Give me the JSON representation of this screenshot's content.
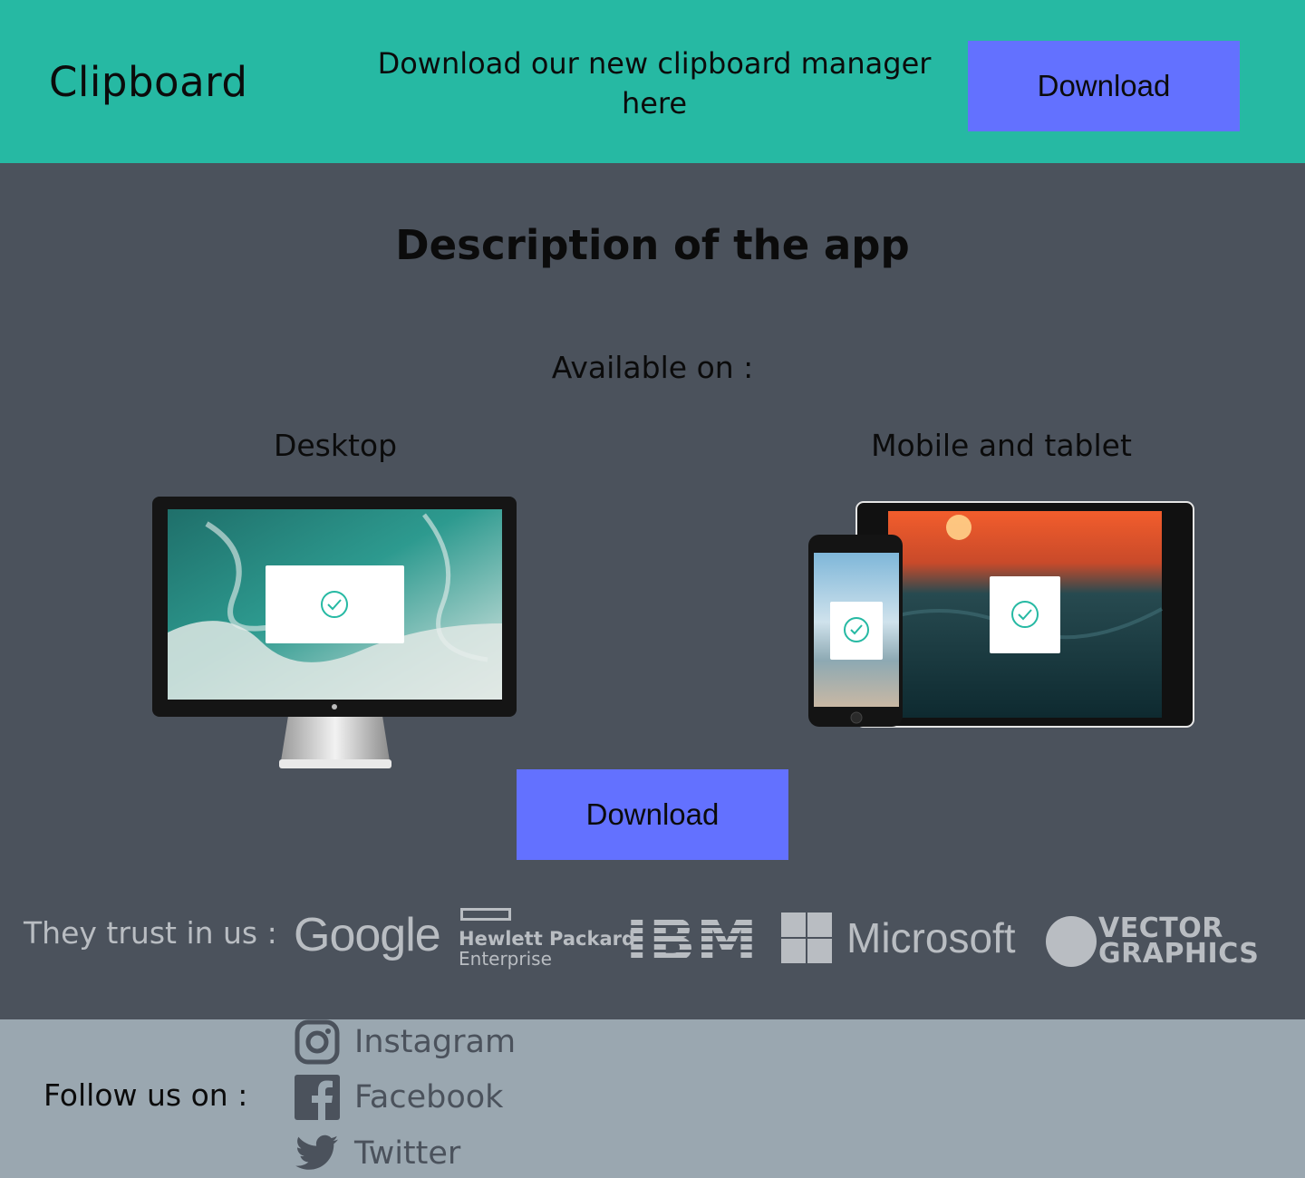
{
  "header": {
    "logo": "Clipboard",
    "tagline": "Download our new clipboard manager here",
    "download_label": "Download"
  },
  "main": {
    "title": "Description of the app",
    "available_on": "Available on :",
    "platforms": [
      {
        "label": "Desktop"
      },
      {
        "label": "Mobile and tablet"
      }
    ],
    "download_label": "Download"
  },
  "trust": {
    "label": "They trust in us :",
    "logos": [
      {
        "name": "Google",
        "text": "Google"
      },
      {
        "name": "Hewlett Packard Enterprise",
        "line1": "Hewlett Packard",
        "line2": "Enterprise"
      },
      {
        "name": "IBM",
        "text": "IBM"
      },
      {
        "name": "Microsoft",
        "text": "Microsoft"
      },
      {
        "name": "Vector Graphics",
        "line1": "VECTOR",
        "line2": "GRAPHICS"
      }
    ]
  },
  "footer": {
    "follow_label": "Follow us on :",
    "social": [
      {
        "label": "Instagram",
        "icon": "instagram-icon"
      },
      {
        "label": "Facebook",
        "icon": "facebook-icon"
      },
      {
        "label": "Twitter",
        "icon": "twitter-icon"
      }
    ]
  },
  "colors": {
    "header_bg": "#26b9a3",
    "main_bg": "#4b525c",
    "footer_bg": "#9aa7b0",
    "button_bg": "#6371ff",
    "logo_gray": "#b9bdc2"
  }
}
